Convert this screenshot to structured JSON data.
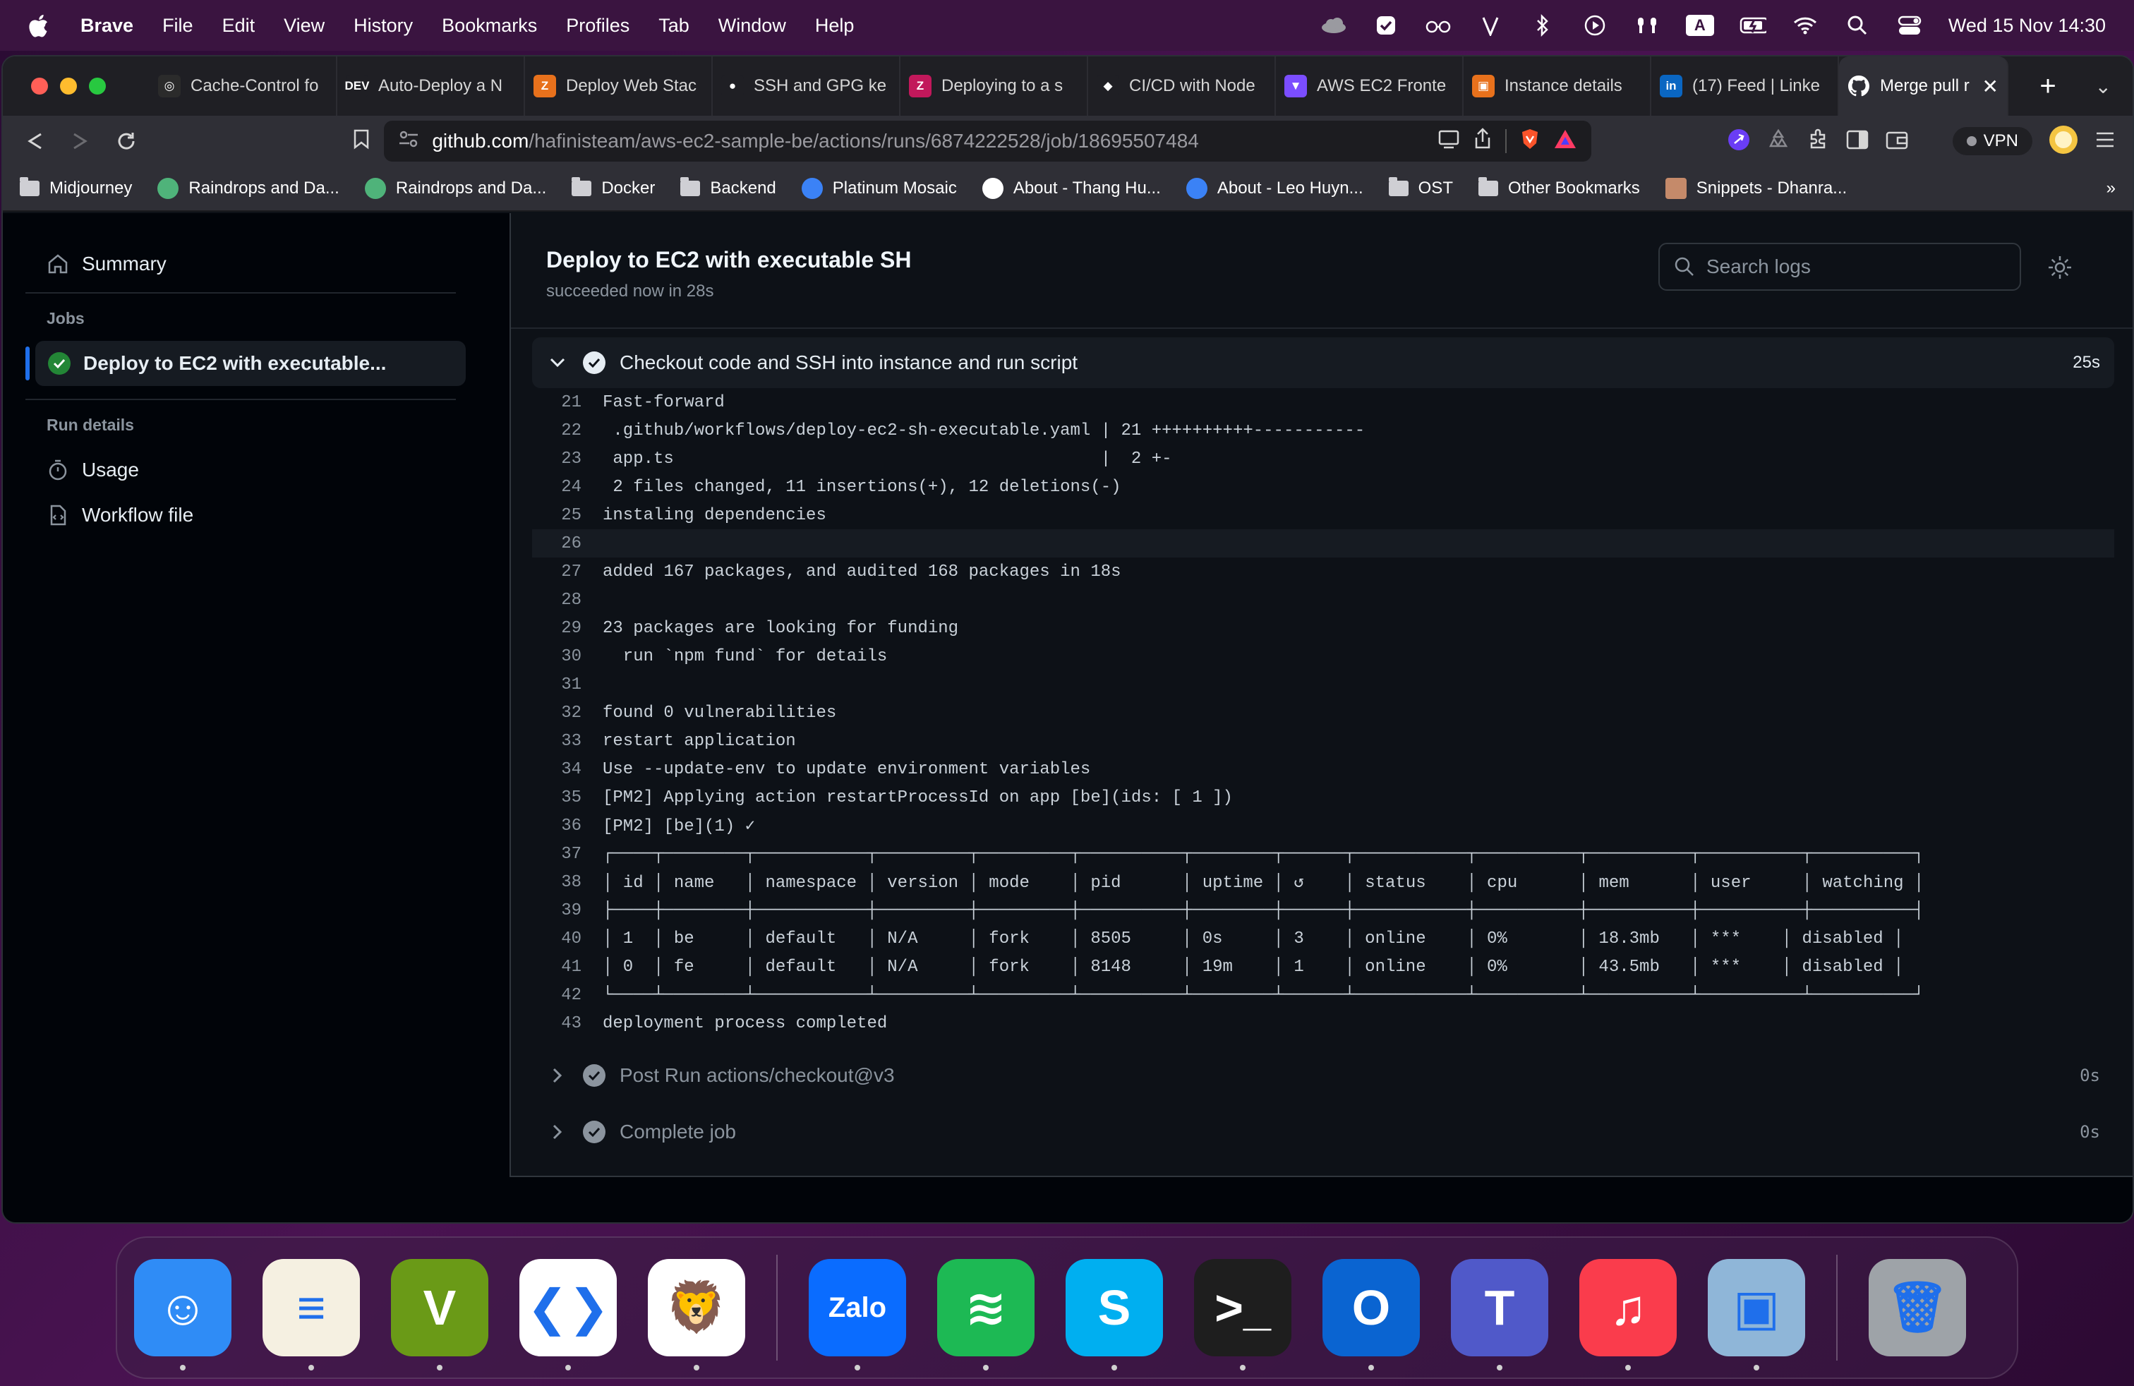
{
  "menubar": {
    "app": "Brave",
    "items": [
      "File",
      "Edit",
      "View",
      "History",
      "Bookmarks",
      "Profiles",
      "Tab",
      "Window",
      "Help"
    ],
    "input_badge": "A",
    "clock": "Wed 15 Nov  14:30"
  },
  "tabs": [
    {
      "title": "Cache-Control fo",
      "icon": "openai-icon",
      "color": "#2b2b2b",
      "glyph": "◎"
    },
    {
      "title": "Auto-Deploy a N",
      "icon": "dev-icon",
      "color": "#1f1f24",
      "glyph": "DEV"
    },
    {
      "title": "Deploy Web Stac",
      "icon": "zoho-icon",
      "color": "#e8711c",
      "glyph": "Z"
    },
    {
      "title": "SSH and GPG ke",
      "icon": "github-icon",
      "color": "#1f1f24",
      "glyph": "●"
    },
    {
      "title": "Deploying to a s",
      "icon": "zeit-icon",
      "color": "#c2185b",
      "glyph": "Z"
    },
    {
      "title": "CI/CD with Node",
      "icon": "codecov-icon",
      "color": "#1f1f24",
      "glyph": "◆"
    },
    {
      "title": "AWS EC2 Fronte",
      "icon": "vite-icon",
      "color": "#7b4dff",
      "glyph": "▼"
    },
    {
      "title": "Instance details",
      "icon": "aws-icon",
      "color": "#e8711c",
      "glyph": "▣"
    },
    {
      "title": "(17) Feed | Linke",
      "icon": "linkedin-icon",
      "color": "#0a66c2",
      "glyph": "in"
    }
  ],
  "active_tab": {
    "title": "Merge pull r",
    "icon": "github-icon"
  },
  "url": {
    "host": "github.com",
    "path": "/hafinisteam/aws-ec2-sample-be/actions/runs/6874222528/job/18695507484"
  },
  "vpn_label": "VPN",
  "bookmarks": [
    {
      "label": "Midjourney",
      "icon": "folder-icon"
    },
    {
      "label": "Raindrops and Da...",
      "icon": "globe-icon"
    },
    {
      "label": "Raindrops and Da...",
      "icon": "globe-icon"
    },
    {
      "label": "Docker",
      "icon": "folder-icon"
    },
    {
      "label": "Backend",
      "icon": "folder-icon"
    },
    {
      "label": "Platinum Mosaic",
      "icon": "globe-icon"
    },
    {
      "label": "About - Thang Hu...",
      "icon": "globe-icon"
    },
    {
      "label": "About - Leo Huyn...",
      "icon": "globe-icon"
    },
    {
      "label": "OST",
      "icon": "folder-icon"
    },
    {
      "label": "Other Bookmarks",
      "icon": "folder-icon"
    },
    {
      "label": "Snippets - Dhanra...",
      "icon": "avatar-icon"
    }
  ],
  "sidebar": {
    "summary": "Summary",
    "jobs_heading": "Jobs",
    "job_item": "Deploy to EC2 with executable...",
    "run_details_heading": "Run details",
    "usage": "Usage",
    "workflow_file": "Workflow file"
  },
  "job": {
    "title": "Deploy to EC2 with executable SH",
    "status": "succeeded now in 28s",
    "search_placeholder": "Search logs"
  },
  "steps": [
    {
      "label": "Checkout code and SSH into instance and run script",
      "duration": "25s",
      "expanded": true
    },
    {
      "label": "Post Run actions/checkout@v3",
      "duration": "0s",
      "expanded": false
    },
    {
      "label": "Complete job",
      "duration": "0s",
      "expanded": false
    }
  ],
  "log_lines": [
    {
      "n": "21",
      "t": "Fast-forward"
    },
    {
      "n": "22",
      "t": " .github/workflows/deploy-ec2-sh-executable.yaml | 21 ++++++++++-----------"
    },
    {
      "n": "23",
      "t": " app.ts                                          |  2 +-"
    },
    {
      "n": "24",
      "t": " 2 files changed, 11 insertions(+), 12 deletions(-)"
    },
    {
      "n": "25",
      "t": "instaling dependencies"
    },
    {
      "n": "26",
      "t": ""
    },
    {
      "n": "27",
      "t": "added 167 packages, and audited 168 packages in 18s"
    },
    {
      "n": "28",
      "t": ""
    },
    {
      "n": "29",
      "t": "23 packages are looking for funding"
    },
    {
      "n": "30",
      "t": "  run `npm fund` for details"
    },
    {
      "n": "31",
      "t": ""
    },
    {
      "n": "32",
      "t": "found 0 vulnerabilities"
    },
    {
      "n": "33",
      "t": "restart application"
    },
    {
      "n": "34",
      "t": "Use --update-env to update environment variables"
    },
    {
      "n": "35",
      "t": "[PM2] Applying action restartProcessId on app [be](ids: [ 1 ])"
    },
    {
      "n": "36",
      "t": "[PM2] [be](1) ✓"
    },
    {
      "n": "37",
      "t": "┌────┬────────┬───────────┬─────────┬─────────┬──────────┬────────┬──────┬───────────┬──────────┬──────────┬──────────┬──────────┐"
    },
    {
      "n": "38",
      "t": "│ id │ name   │ namespace │ version │ mode    │ pid      │ uptime │ ↺    │ status    │ cpu      │ mem      │ user     │ watching │"
    },
    {
      "n": "39",
      "t": "├────┼────────┼───────────┼─────────┼─────────┼──────────┼────────┼──────┼───────────┼──────────┼──────────┼──────────┼──────────┤"
    },
    {
      "n": "40",
      "t": "│ 1  │ be     │ default   │ N/A     │ fork    │ 8505     │ 0s     │ 3    │ online    │ 0%       │ 18.3mb   │ ***    │ disabled │"
    },
    {
      "n": "41",
      "t": "│ 0  │ fe     │ default   │ N/A     │ fork    │ 8148     │ 19m    │ 1    │ online    │ 0%       │ 43.5mb   │ ***    │ disabled │"
    },
    {
      "n": "42",
      "t": "└────┴────────┴───────────┴─────────┴─────────┴──────────┴────────┴──────┴───────────┴──────────┴──────────┴──────────┴──────────┘"
    },
    {
      "n": "43",
      "t": "deployment process completed"
    }
  ],
  "highlighted_line": "26",
  "dock": [
    {
      "name": "finder",
      "color": "#2f8cf6",
      "glyph": "☺"
    },
    {
      "name": "notes",
      "color": "#f5f0e1",
      "glyph": "≡"
    },
    {
      "name": "vim",
      "color": "#6a9a17",
      "glyph": "V"
    },
    {
      "name": "vscode",
      "color": "#ffffff",
      "glyph": "❮❯"
    },
    {
      "name": "brave",
      "color": "#ffffff",
      "glyph": "🦁"
    },
    {
      "name": "zalo",
      "color": "#0a6cff",
      "glyph": "Zalo"
    },
    {
      "name": "spotify",
      "color": "#1db954",
      "glyph": "≋"
    },
    {
      "name": "skype",
      "color": "#00aff0",
      "glyph": "S"
    },
    {
      "name": "terminal",
      "color": "#1e1e1e",
      "glyph": ">_"
    },
    {
      "name": "outlook",
      "color": "#0a64d1",
      "glyph": "O"
    },
    {
      "name": "teams",
      "color": "#5059c9",
      "glyph": "T"
    },
    {
      "name": "music",
      "color": "#fa3c4c",
      "glyph": "♫"
    },
    {
      "name": "preview",
      "color": "#8fb6d8",
      "glyph": "▣"
    },
    {
      "name": "trash",
      "color": "#9ea3a8",
      "glyph": "🗑"
    }
  ],
  "colors": {
    "accent": "#1f6feb",
    "success": "#238636",
    "bg": "#0d1117"
  }
}
